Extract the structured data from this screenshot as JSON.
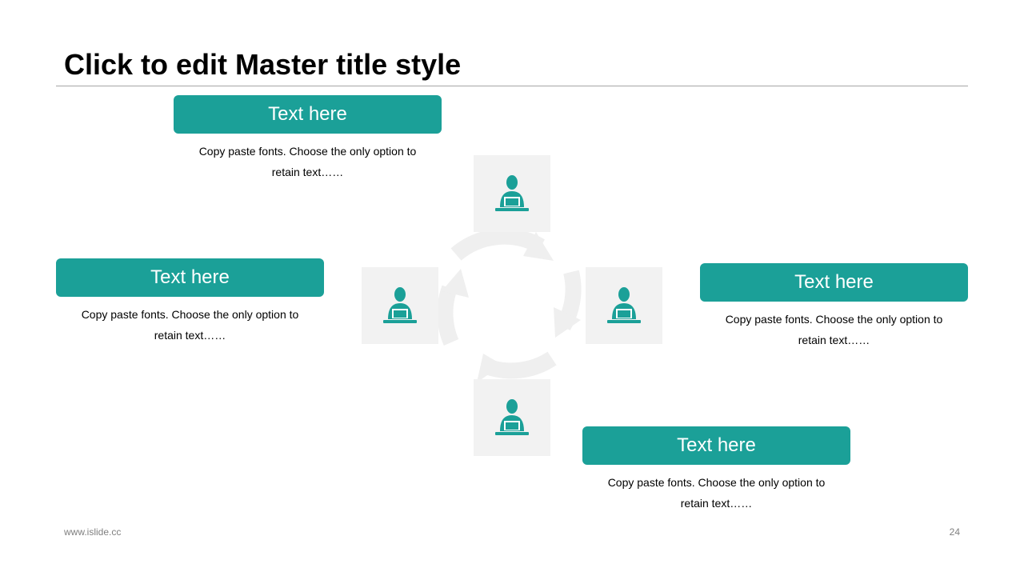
{
  "slide": {
    "title": "Click to edit Master title style",
    "footer_url": "www.islide.cc",
    "page_number": "24"
  },
  "colors": {
    "accent": "#1ba098",
    "tile_bg": "#f2f2f2",
    "cycle": "#efefef"
  },
  "icons": {
    "tile": "person-at-laptop-icon",
    "cycle": "circular-arrows-icon"
  },
  "blocks": [
    {
      "label": "Text here",
      "text": "Copy paste fonts. Choose the only option to retain text……"
    },
    {
      "label": "Text here",
      "text": "Copy paste fonts. Choose the only option to retain text……"
    },
    {
      "label": "Text here",
      "text": "Copy paste fonts. Choose the only option to retain text……"
    },
    {
      "label": "Text here",
      "text": "Copy paste fonts. Choose the only option to retain text……"
    }
  ]
}
